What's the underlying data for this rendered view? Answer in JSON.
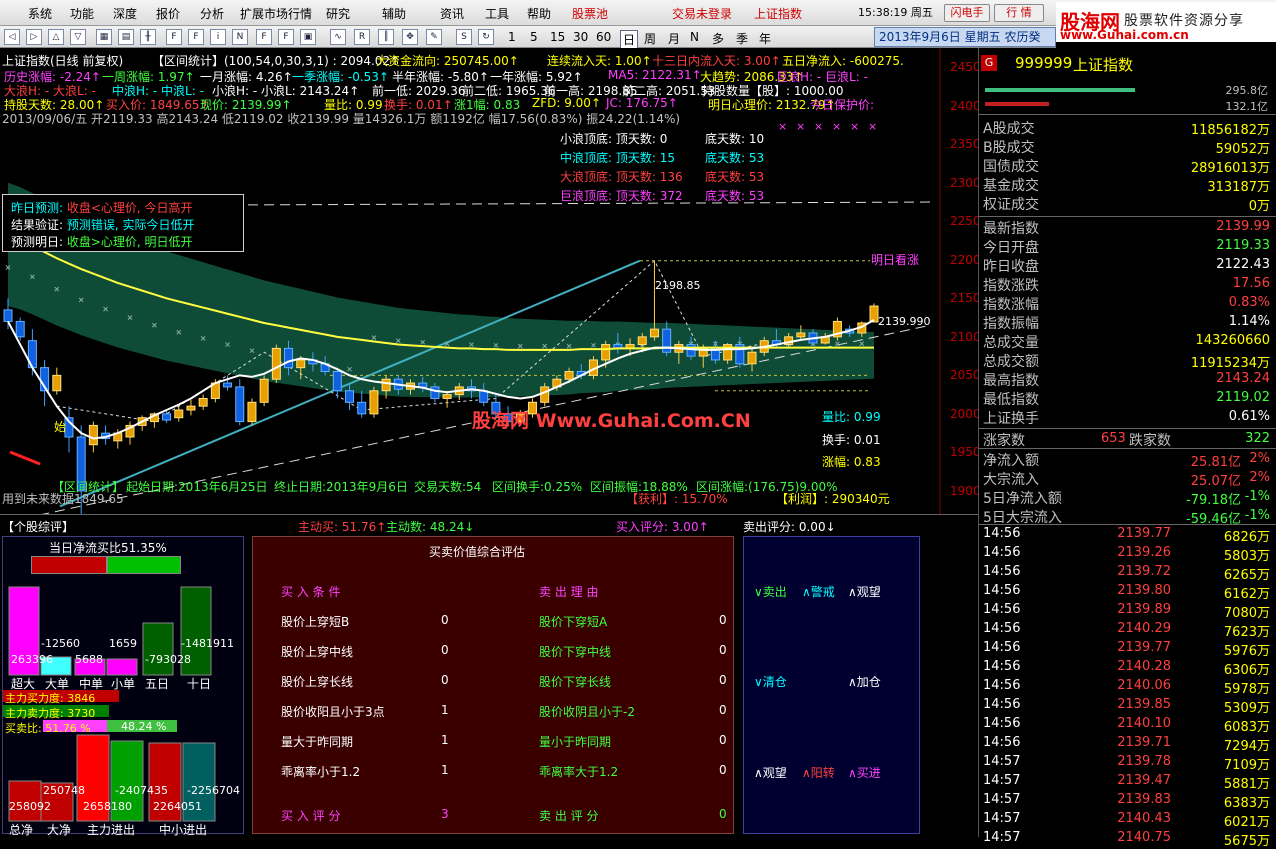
{
  "menu": {
    "items": [
      "系统",
      "功能",
      "深度",
      "报价",
      "分析",
      "扩展市场行情",
      "研究",
      "辅助",
      "资讯",
      "工具",
      "帮助"
    ],
    "stock_pool": "股票池",
    "trade_login": "交易未登录",
    "index_name": "上证指数",
    "clock": "15:38:19 周五",
    "flash": "闪电手",
    "quote": "行 情"
  },
  "logo": {
    "title": "股海网",
    "subtitle": "股票软件资源分享",
    "url": "www.Guhai.com.cn"
  },
  "toolbar": {
    "periods": [
      "1",
      "5",
      "15",
      "30",
      "60",
      "日",
      "周",
      "月",
      "N",
      "多",
      "季",
      "年"
    ],
    "date": "2013年9月6日  星期五  农历癸"
  },
  "chart": {
    "hdr1": [
      {
        "t": "上证指数(日线 前复权)",
        "c": "w"
      },
      {
        "t": "【区间统计】(100,54,0,30,3,1)  : 2094.02↑",
        "c": "w"
      },
      {
        "t": "大资金流向: 250745.00↑",
        "c": "y"
      },
      {
        "t": "连续流入天: 1.00↑",
        "c": "y"
      },
      {
        "t": "十三日内流入天: 3.00↑",
        "c": "r"
      },
      {
        "t": "五日净流入: -600275.",
        "c": "y"
      }
    ],
    "hdr2": [
      {
        "t": "历史涨幅: -2.24↑",
        "c": "m"
      },
      {
        "t": "一周涨幅: 1.97↑",
        "c": "g"
      },
      {
        "t": "一月涨幅: 4.26↑",
        "c": "w"
      },
      {
        "t": "一季涨幅: -0.53↑",
        "c": "c"
      },
      {
        "t": "半年涨幅: -5.80↑",
        "c": "w"
      },
      {
        "t": "一年涨幅: 5.92↑",
        "c": "w"
      },
      {
        "t": "MA5: 2122.31↑",
        "c": "m"
      },
      {
        "t": "大趋势: 2086.33↑",
        "c": "y"
      },
      {
        "t": "巨浪H: - 巨浪L: -",
        "c": "m"
      }
    ],
    "hdr3": [
      {
        "t": "大浪H: - 大浪L: -",
        "c": "r"
      },
      {
        "t": "中浪H: - 中浪L: -",
        "c": "c"
      },
      {
        "t": "小浪H: - 小浪L: 2143.24↑",
        "c": "w"
      },
      {
        "t": "前一低: 2029.36",
        "c": "w"
      },
      {
        "t": "前二低: 1965.36",
        "c": "w"
      },
      {
        "t": "前一高: 2198.85",
        "c": "w"
      },
      {
        "t": "前二高: 2051.53",
        "c": "w"
      },
      {
        "t": "持股数量【股】: 1000.00",
        "c": "w"
      }
    ],
    "hdr4": [
      {
        "t": "持股天数: 28.00↑",
        "c": "y"
      },
      {
        "t": "买入价: 1849.65↑",
        "c": "r"
      },
      {
        "t": "现价: 2139.99↑",
        "c": "g"
      },
      {
        "t": "量比: 0.99",
        "c": "y"
      },
      {
        "t": "换手: 0.01↑",
        "c": "r"
      },
      {
        "t": "涨1幅: 0.83",
        "c": "g"
      },
      {
        "t": "ZFD: 9.00↑",
        "c": "y"
      },
      {
        "t": "JC: 176.75↑",
        "c": "m"
      },
      {
        "t": "明日心理价: 2132.79↑",
        "c": "y"
      },
      {
        "t": "今日保护价:",
        "c": "m"
      }
    ],
    "hdr5": "2013/09/06/五 开2119.33 高2143.24 低2119.02 收2139.99 量14326.1万 额1192亿 幅17.56(0.83%) 振24.22(1.14%)",
    "predict": [
      {
        "k": "昨日预测:",
        "v": "收盘<心理价, 今日高开",
        "kc": "c",
        "vc": "r"
      },
      {
        "k": "结果验证:",
        "v": "预测错误, 实际今日低开",
        "kc": "w",
        "vc": "c"
      },
      {
        "k": "预测明日:",
        "v": "收盘>心理价, 明日低开",
        "kc": "w",
        "vc": "g"
      }
    ],
    "waves": [
      {
        "name": "小浪顶底:",
        "top": "顶天数: 0",
        "bot": "底天数: 10",
        "c": "w"
      },
      {
        "name": "中浪顶底:",
        "top": "顶天数: 15",
        "bot": "底天数: 53",
        "c": "c"
      },
      {
        "name": "大浪顶底:",
        "top": "顶天数: 136",
        "bot": "底天数: 53",
        "c": "r"
      },
      {
        "name": "巨浪顶底:",
        "top": "顶天数: 372",
        "bot": "底天数: 53",
        "c": "m"
      }
    ],
    "yaxis": [
      "2450",
      "2400",
      "2350",
      "2300",
      "2250",
      "2200",
      "2150",
      "2100",
      "2050",
      "2000",
      "1950",
      "1900"
    ],
    "label_high": "2198.85",
    "label_last": "2139.990",
    "tomorrow": "明日看涨",
    "lbl_start": "始",
    "liangbi": "量比: 0.99",
    "huanshou": "换手: 0.01",
    "zhangfu": "涨幅: 0.83",
    "watermark": "股海网 Www.Guhai.Com.CN",
    "stats": [
      {
        "t": "【区间统计】",
        "c": "g"
      },
      {
        "t": "起始日期:2013年6月25日",
        "c": "g"
      },
      {
        "t": "终止日期:2013年9月6日",
        "c": "g"
      },
      {
        "t": "交易天数:54",
        "c": "g"
      },
      {
        "t": "区间换手:0.25%",
        "c": "g"
      },
      {
        "t": "区间振幅:18.88%",
        "c": "g"
      },
      {
        "t": "区间涨幅:(176.75)9.00%",
        "c": "g"
      }
    ],
    "buyline": "用到未来数据1849.65",
    "profit_pct": "【获利】: 15.70%",
    "profit": "【利润】: 290340元"
  },
  "chart_data": {
    "type": "candlestick",
    "candles": [
      [
        2135,
        2150,
        2110,
        2120
      ],
      [
        2120,
        2125,
        2095,
        2100
      ],
      [
        2095,
        2110,
        2050,
        2060
      ],
      [
        2060,
        2070,
        2010,
        2030
      ],
      [
        2030,
        2060,
        2025,
        2050
      ],
      [
        1995,
        2010,
        1950,
        1970
      ],
      [
        1970,
        1985,
        1850,
        1900
      ],
      [
        1960,
        1990,
        1950,
        1985
      ],
      [
        1975,
        1985,
        1960,
        1968
      ],
      [
        1965,
        1980,
        1955,
        1975
      ],
      [
        1970,
        1990,
        1960,
        1985
      ],
      [
        1985,
        1998,
        1978,
        1995
      ],
      [
        1990,
        2002,
        1982,
        2000
      ],
      [
        2000,
        2005,
        1988,
        1992
      ],
      [
        1995,
        2010,
        1990,
        2005
      ],
      [
        2005,
        2018,
        1998,
        2010
      ],
      [
        2010,
        2025,
        2005,
        2020
      ],
      [
        2020,
        2045,
        2015,
        2040
      ],
      [
        2040,
        2050,
        2030,
        2035
      ],
      [
        2035,
        2045,
        1985,
        1990
      ],
      [
        1990,
        2020,
        1985,
        2015
      ],
      [
        2015,
        2050,
        2010,
        2045
      ],
      [
        2045,
        2090,
        2040,
        2085
      ],
      [
        2085,
        2095,
        2050,
        2060
      ],
      [
        2060,
        2075,
        2045,
        2070
      ],
      [
        2070,
        2080,
        2055,
        2065
      ],
      [
        2065,
        2075,
        2050,
        2055
      ],
      [
        2055,
        2060,
        2020,
        2030
      ],
      [
        2030,
        2040,
        2005,
        2015
      ],
      [
        2015,
        2030,
        1995,
        2000
      ],
      [
        2000,
        2035,
        1995,
        2030
      ],
      [
        2030,
        2050,
        2020,
        2045
      ],
      [
        2045,
        2050,
        2025,
        2032
      ],
      [
        2032,
        2045,
        2025,
        2040
      ],
      [
        2040,
        2048,
        2028,
        2035
      ],
      [
        2035,
        2040,
        2015,
        2020
      ],
      [
        2020,
        2030,
        2008,
        2025
      ],
      [
        2025,
        2040,
        2018,
        2035
      ],
      [
        2035,
        2045,
        2020,
        2030
      ],
      [
        2030,
        2040,
        2010,
        2015
      ],
      [
        2015,
        2025,
        1995,
        2000
      ],
      [
        2000,
        2010,
        1985,
        1990
      ],
      [
        1990,
        2005,
        1985,
        2000
      ],
      [
        2000,
        2020,
        1995,
        2015
      ],
      [
        2015,
        2040,
        2010,
        2035
      ],
      [
        2035,
        2050,
        2030,
        2045
      ],
      [
        2045,
        2060,
        2040,
        2055
      ],
      [
        2055,
        2065,
        2045,
        2050
      ],
      [
        2050,
        2075,
        2045,
        2070
      ],
      [
        2070,
        2095,
        2060,
        2090
      ],
      [
        2090,
        2105,
        2078,
        2085
      ],
      [
        2085,
        2098,
        2075,
        2090
      ],
      [
        2090,
        2105,
        2080,
        2100
      ],
      [
        2100,
        2198,
        2095,
        2110
      ],
      [
        2110,
        2120,
        2075,
        2080
      ],
      [
        2080,
        2095,
        2065,
        2090
      ],
      [
        2090,
        2100,
        2070,
        2075
      ],
      [
        2075,
        2090,
        2060,
        2085
      ],
      [
        2085,
        2095,
        2065,
        2070
      ],
      [
        2070,
        2092,
        2065,
        2090
      ],
      [
        2090,
        2100,
        2060,
        2065
      ],
      [
        2065,
        2085,
        2055,
        2080
      ],
      [
        2080,
        2100,
        2075,
        2095
      ],
      [
        2095,
        2110,
        2085,
        2090
      ],
      [
        2090,
        2105,
        2085,
        2100
      ],
      [
        2100,
        2115,
        2095,
        2105
      ],
      [
        2105,
        2110,
        2088,
        2092
      ],
      [
        2092,
        2105,
        2090,
        2100
      ],
      [
        2100,
        2125,
        2095,
        2120
      ],
      [
        2110,
        2115,
        2100,
        2105
      ],
      [
        2105,
        2120,
        2100,
        2118
      ],
      [
        2119.33,
        2143.24,
        2119.02,
        2139.99
      ]
    ],
    "ma_white": [
      2120,
      2090,
      2060,
      2035,
      2010,
      1990,
      1975,
      1968,
      1970,
      1975,
      1982,
      1990,
      1998,
      2005,
      2012,
      2020,
      2030,
      2040,
      2045,
      2050,
      2048,
      2052,
      2060,
      2068,
      2072,
      2070,
      2065,
      2058,
      2050,
      2045,
      2042,
      2040,
      2038,
      2036,
      2034,
      2030,
      2028,
      2030,
      2032,
      2030,
      2026,
      2022,
      2020,
      2022,
      2028,
      2035,
      2042,
      2050,
      2058,
      2065,
      2072,
      2078,
      2082,
      2086,
      2086,
      2085,
      2084,
      2083,
      2083,
      2084,
      2084,
      2085,
      2087,
      2090,
      2093,
      2096,
      2098,
      2100,
      2104,
      2108,
      2113,
      2122
    ],
    "ma_yellow": [
      2230,
      2225,
      2218,
      2210,
      2202,
      2195,
      2188,
      2182,
      2176,
      2170,
      2165,
      2160,
      2155,
      2150,
      2146,
      2142,
      2138,
      2134,
      2130,
      2126,
      2122,
      2118,
      2115,
      2112,
      2109,
      2106,
      2103,
      2100,
      2098,
      2096,
      2094,
      2092,
      2090,
      2089,
      2088,
      2087,
      2086,
      2085,
      2085,
      2084,
      2084,
      2083,
      2083,
      2083,
      2083,
      2083,
      2083,
      2084,
      2084,
      2084,
      2085,
      2085,
      2085,
      2085,
      2086,
      2086,
      2086,
      2086,
      2086,
      2086,
      2086,
      2086,
      2086,
      2086,
      2086,
      2086,
      2086,
      2086,
      2086,
      2086,
      2086,
      2086
    ],
    "ylim": [
      1870,
      2475
    ]
  },
  "right": {
    "code": "999999",
    "name": "上证指数",
    "bar1_val": "295.8亿",
    "bar2_val": "132.1亿",
    "rows1": [
      {
        "k": "A股成交",
        "v": "11856182万",
        "c": "y"
      },
      {
        "k": "B股成交",
        "v": "59052万",
        "c": "y"
      },
      {
        "k": "国债成交",
        "v": "28916013万",
        "c": "y"
      },
      {
        "k": "基金成交",
        "v": "313187万",
        "c": "y"
      },
      {
        "k": "权证成交",
        "v": "0万",
        "c": "y"
      }
    ],
    "rows2": [
      {
        "k": "最新指数",
        "v": "2139.99",
        "c": "r"
      },
      {
        "k": "今日开盘",
        "v": "2119.33",
        "c": "g"
      },
      {
        "k": "昨日收盘",
        "v": "2122.43",
        "c": "w"
      },
      {
        "k": "指数涨跌",
        "v": "17.56",
        "c": "r"
      },
      {
        "k": "指数涨幅",
        "v": "0.83%",
        "c": "r"
      },
      {
        "k": "指数振幅",
        "v": "1.14%",
        "c": "w"
      },
      {
        "k": "总成交量",
        "v": "143260660",
        "c": "y"
      },
      {
        "k": "总成交额",
        "v": "11915234万",
        "c": "y"
      },
      {
        "k": "最高指数",
        "v": "2143.24",
        "c": "r"
      },
      {
        "k": "最低指数",
        "v": "2119.02",
        "c": "g"
      },
      {
        "k": "上证换手",
        "v": "0.61%",
        "c": "w"
      }
    ],
    "zhang_label": "涨家数",
    "zhang": "653",
    "die_label": "跌家数",
    "die": "322",
    "flows": [
      {
        "k": "净流入额",
        "v": "25.81亿",
        "p": "2%",
        "c": "r"
      },
      {
        "k": "大宗流入",
        "v": "25.07亿",
        "p": "2%",
        "c": "r"
      },
      {
        "k": "5日净流入额",
        "v": "-79.18亿",
        "p": "-1%",
        "c": "g"
      },
      {
        "k": "5日大宗流入",
        "v": "-59.46亿",
        "p": "-1%",
        "c": "g"
      }
    ],
    "ticks": [
      [
        "14:56",
        "2139.77",
        "6826万"
      ],
      [
        "14:56",
        "2139.26",
        "5803万"
      ],
      [
        "14:56",
        "2139.72",
        "6265万"
      ],
      [
        "14:56",
        "2139.80",
        "6162万"
      ],
      [
        "14:56",
        "2139.89",
        "7080万"
      ],
      [
        "14:56",
        "2140.29",
        "7623万"
      ],
      [
        "14:56",
        "2139.77",
        "5976万"
      ],
      [
        "14:56",
        "2140.28",
        "6306万"
      ],
      [
        "14:56",
        "2140.06",
        "5978万"
      ],
      [
        "14:56",
        "2139.85",
        "5309万"
      ],
      [
        "14:56",
        "2140.10",
        "6083万"
      ],
      [
        "14:56",
        "2139.71",
        "7294万"
      ],
      [
        "14:57",
        "2139.78",
        "7109万"
      ],
      [
        "14:57",
        "2139.47",
        "5881万"
      ],
      [
        "14:57",
        "2139.83",
        "6383万"
      ],
      [
        "14:57",
        "2140.43",
        "6021万"
      ],
      [
        "14:57",
        "2140.75",
        "5675万"
      ]
    ]
  },
  "bottom": {
    "tab": "【个股综评】",
    "zhudong_buy": "主动买: 51.76↑",
    "zhudong_sell": "主动数: 48.24↓",
    "buy_score": "买入评分: 3.00↑",
    "sell_score": "卖出评分: 0.00↓",
    "flow_title": "当日净流买比51.35%",
    "flow_vals": {
      "chaoda": "263396",
      "dadan": "-12560",
      "zhongdan": "5688",
      "xiaodan": "1659",
      "wuri": "-793028",
      "shiri": "-1481911"
    },
    "flow_labels": [
      "超大",
      "大单",
      "中单",
      "小单",
      "五日",
      "十日"
    ],
    "zl_buy": "主力买力度: 3846",
    "zl_sell": "主力卖力度: 3730",
    "buysell_ratio": "买卖比: 51.76 %",
    "buysell_ratio2": "48.24 %",
    "net_vals": {
      "zongjing": "258092",
      "dajing": "250748",
      "zl_in": "2658180",
      "zl_out": "-2407435",
      "zx_in": "2264051",
      "zx_out": "-2256704"
    },
    "net_labels": [
      "总净",
      "大净",
      "主力进出",
      "中小进出"
    ],
    "eval_title": "买卖价值综合评估",
    "buy_head": "买  入  条  件",
    "sell_head": "卖  出  理  由",
    "buy_conds": [
      [
        "股价上穿短B",
        "0"
      ],
      [
        "股价上穿中线",
        "0"
      ],
      [
        "股价上穿长线",
        "0"
      ],
      [
        "股价收阳且小于3点",
        "1"
      ],
      [
        "量大于昨同期",
        "1"
      ],
      [
        "乖离率小于1.2",
        "1"
      ]
    ],
    "sell_conds": [
      [
        "股价下穿短A",
        "0"
      ],
      [
        "股价下穿中线",
        "0"
      ],
      [
        "股价下穿长线",
        "0"
      ],
      [
        "股价收阴且小于-2",
        "0"
      ],
      [
        "量小于昨同期",
        "0"
      ],
      [
        "乖离率大于1.2",
        "0"
      ]
    ],
    "buy_total_label": "买  入  评  分",
    "buy_total": "3",
    "sell_total_label": "卖  出  评  分",
    "sell_total": "0",
    "advice": [
      {
        "t": "∨卖出",
        "c": "g"
      },
      {
        "t": "∧警戒",
        "c": "c"
      },
      {
        "t": "∧观望",
        "c": "w"
      },
      {
        "t": "∨清仓",
        "c": "c"
      },
      {
        "t": "∧加仓",
        "c": "w"
      },
      {
        "t": "∧观望",
        "c": "w"
      },
      {
        "t": "∧阳转",
        "c": "r"
      },
      {
        "t": "∧买进",
        "c": "m"
      }
    ]
  }
}
